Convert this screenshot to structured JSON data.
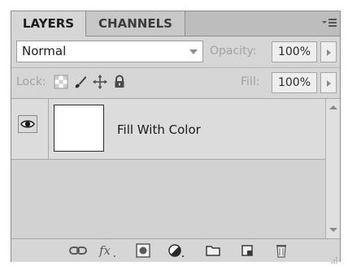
{
  "tabs": [
    {
      "label": "LAYERS",
      "active": true
    },
    {
      "label": "CHANNELS",
      "active": false
    }
  ],
  "panel_menu": {
    "icon": "panel-menu-icon"
  },
  "blend_mode": {
    "value": "Normal"
  },
  "opacity": {
    "label": "Opacity:",
    "value": "100%"
  },
  "lock": {
    "label": "Lock:",
    "icons": [
      "lock-transparent-pixels-icon",
      "lock-image-pixels-icon",
      "lock-position-icon",
      "lock-all-icon"
    ]
  },
  "fill": {
    "label": "Fill:",
    "value": "100%"
  },
  "layers": [
    {
      "name": "Fill With Color",
      "visible": true,
      "thumbnail_color": "#ffffff"
    }
  ],
  "toolbar": {
    "icons": [
      "link-layers-icon",
      "layer-style-fx-icon",
      "layer-mask-icon",
      "adjustment-layer-icon",
      "new-group-icon",
      "new-layer-icon",
      "delete-layer-icon"
    ]
  },
  "colors": {
    "panel_bg": "#d6d6d6",
    "tab_bar": "#bdbdbd",
    "disabled_text": "#a2a2a2"
  }
}
